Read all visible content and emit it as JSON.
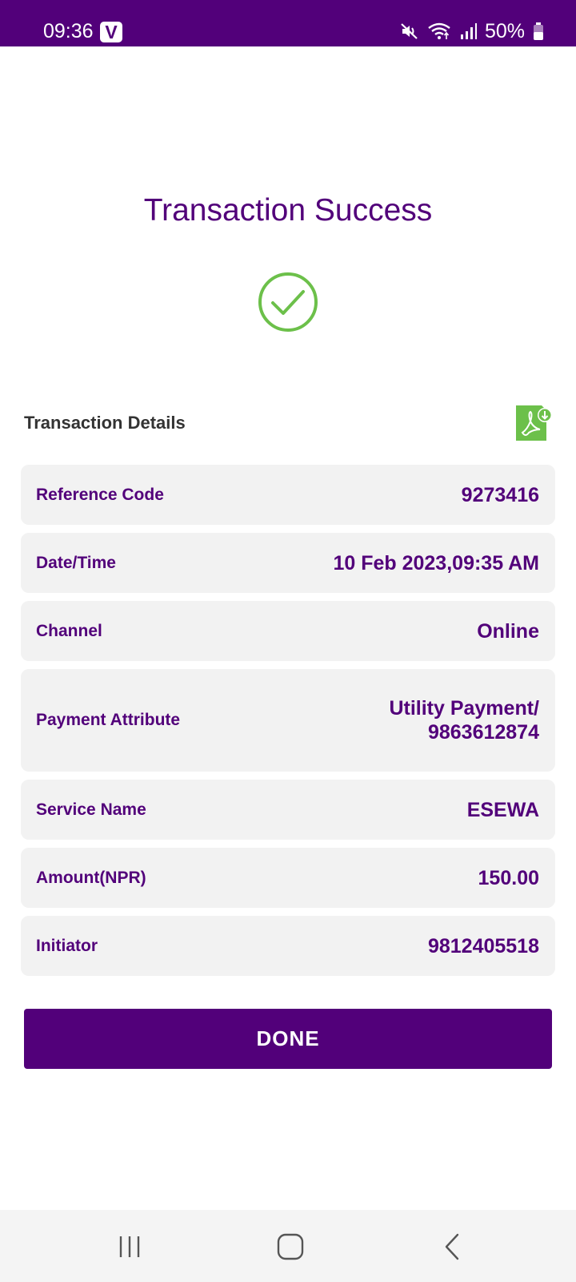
{
  "status_bar": {
    "time": "09:36",
    "app_badge": "V",
    "battery": "50%"
  },
  "title": "Transaction Success",
  "details_heading": "Transaction Details",
  "details": [
    {
      "label": "Reference Code",
      "value": "9273416"
    },
    {
      "label": "Date/Time",
      "value": "10 Feb 2023,09:35 AM"
    },
    {
      "label": "Channel",
      "value": "Online"
    },
    {
      "label": "Payment Attribute",
      "value": "Utility Payment/\n9863612874"
    },
    {
      "label": "Service Name",
      "value": "ESEWA"
    },
    {
      "label": "Amount(NPR)",
      "value": "150.00"
    },
    {
      "label": "Initiator",
      "value": "9812405518"
    }
  ],
  "done_label": "DONE",
  "colors": {
    "brand": "#52007a",
    "success": "#6cc04a",
    "row_bg": "#f2f2f2"
  },
  "icons": {
    "status": [
      "mute-icon",
      "wifi-icon",
      "signal-icon",
      "battery-icon"
    ],
    "success": "check-circle-icon",
    "download": "pdf-download-icon",
    "nav": [
      "recent-apps-icon",
      "home-icon",
      "back-icon"
    ]
  }
}
